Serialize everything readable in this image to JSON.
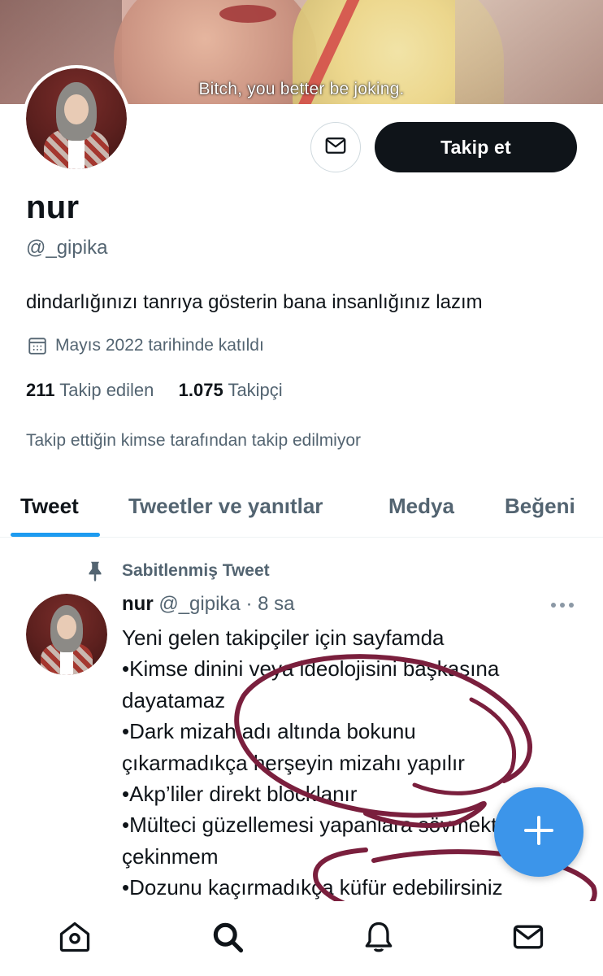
{
  "banner": {
    "caption": "Bitch, you better be joking."
  },
  "profile": {
    "display_name": "nur",
    "handle": "@_gipika",
    "bio": "dindarlığınızı tanrıya gösterin bana insanlığınız lazım",
    "joined": "Mayıs 2022 tarihinde katıldı",
    "following_count": "211",
    "following_label": "Takip edilen",
    "followers_count": "1.075",
    "followers_label": "Takipçi",
    "mutuals_note": "Takip ettiğin kimse tarafından takip edilmiyor",
    "follow_label": "Takip et"
  },
  "tabs": [
    {
      "label": "Tweet",
      "active": true
    },
    {
      "label": "Tweetler ve yanıtlar",
      "active": false
    },
    {
      "label": "Medya",
      "active": false
    },
    {
      "label": "Beğeni",
      "active": false
    }
  ],
  "tweet": {
    "pinned_label": "Sabitlenmiş Tweet",
    "author_name": "nur",
    "author_handle": "@_gipika",
    "separator": "·",
    "time": "8 sa",
    "lines": [
      "Yeni gelen takipçiler için sayfamda",
      "•Kimse dinini veya ideolojisini başkasına",
      "dayatamaz",
      "•Dark mizah adı altında bokunu",
      "çıkarmadıkça herşeyin mizahı yapılır",
      "•Akp’liler direkt blocklanır",
      "•Mülteci güzellemesi yapanlara sövmekten",
      "çekinmem",
      "•Dozunu kaçırmadıkça küfür edebilirsiniz"
    ]
  },
  "icons": {
    "mail": "mail-icon",
    "calendar": "calendar-icon",
    "pin": "pin-icon",
    "more": "more-icon",
    "compose": "plus-icon",
    "nav_home": "home-icon",
    "nav_search": "search-icon",
    "nav_notifications": "bell-icon",
    "nav_messages": "mail-icon"
  },
  "colors": {
    "accent": "#1d9bf0",
    "fab": "#3c95ea",
    "follow_button": "#0f1419",
    "scribble": "#7a1f3d"
  }
}
